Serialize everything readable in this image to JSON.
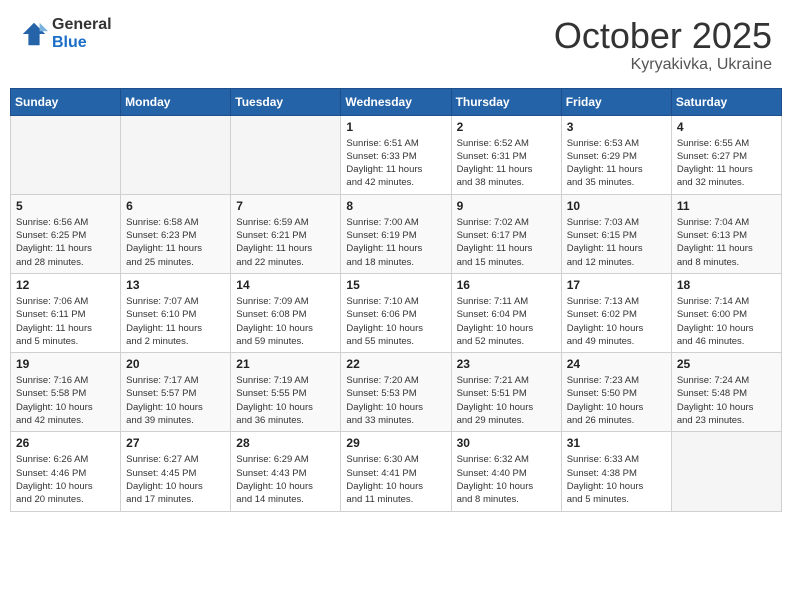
{
  "header": {
    "logo_general": "General",
    "logo_blue": "Blue",
    "month": "October 2025",
    "location": "Kyryakivka, Ukraine"
  },
  "weekdays": [
    "Sunday",
    "Monday",
    "Tuesday",
    "Wednesday",
    "Thursday",
    "Friday",
    "Saturday"
  ],
  "weeks": [
    [
      {
        "day": "",
        "info": ""
      },
      {
        "day": "",
        "info": ""
      },
      {
        "day": "",
        "info": ""
      },
      {
        "day": "1",
        "info": "Sunrise: 6:51 AM\nSunset: 6:33 PM\nDaylight: 11 hours\nand 42 minutes."
      },
      {
        "day": "2",
        "info": "Sunrise: 6:52 AM\nSunset: 6:31 PM\nDaylight: 11 hours\nand 38 minutes."
      },
      {
        "day": "3",
        "info": "Sunrise: 6:53 AM\nSunset: 6:29 PM\nDaylight: 11 hours\nand 35 minutes."
      },
      {
        "day": "4",
        "info": "Sunrise: 6:55 AM\nSunset: 6:27 PM\nDaylight: 11 hours\nand 32 minutes."
      }
    ],
    [
      {
        "day": "5",
        "info": "Sunrise: 6:56 AM\nSunset: 6:25 PM\nDaylight: 11 hours\nand 28 minutes."
      },
      {
        "day": "6",
        "info": "Sunrise: 6:58 AM\nSunset: 6:23 PM\nDaylight: 11 hours\nand 25 minutes."
      },
      {
        "day": "7",
        "info": "Sunrise: 6:59 AM\nSunset: 6:21 PM\nDaylight: 11 hours\nand 22 minutes."
      },
      {
        "day": "8",
        "info": "Sunrise: 7:00 AM\nSunset: 6:19 PM\nDaylight: 11 hours\nand 18 minutes."
      },
      {
        "day": "9",
        "info": "Sunrise: 7:02 AM\nSunset: 6:17 PM\nDaylight: 11 hours\nand 15 minutes."
      },
      {
        "day": "10",
        "info": "Sunrise: 7:03 AM\nSunset: 6:15 PM\nDaylight: 11 hours\nand 12 minutes."
      },
      {
        "day": "11",
        "info": "Sunrise: 7:04 AM\nSunset: 6:13 PM\nDaylight: 11 hours\nand 8 minutes."
      }
    ],
    [
      {
        "day": "12",
        "info": "Sunrise: 7:06 AM\nSunset: 6:11 PM\nDaylight: 11 hours\nand 5 minutes."
      },
      {
        "day": "13",
        "info": "Sunrise: 7:07 AM\nSunset: 6:10 PM\nDaylight: 11 hours\nand 2 minutes."
      },
      {
        "day": "14",
        "info": "Sunrise: 7:09 AM\nSunset: 6:08 PM\nDaylight: 10 hours\nand 59 minutes."
      },
      {
        "day": "15",
        "info": "Sunrise: 7:10 AM\nSunset: 6:06 PM\nDaylight: 10 hours\nand 55 minutes."
      },
      {
        "day": "16",
        "info": "Sunrise: 7:11 AM\nSunset: 6:04 PM\nDaylight: 10 hours\nand 52 minutes."
      },
      {
        "day": "17",
        "info": "Sunrise: 7:13 AM\nSunset: 6:02 PM\nDaylight: 10 hours\nand 49 minutes."
      },
      {
        "day": "18",
        "info": "Sunrise: 7:14 AM\nSunset: 6:00 PM\nDaylight: 10 hours\nand 46 minutes."
      }
    ],
    [
      {
        "day": "19",
        "info": "Sunrise: 7:16 AM\nSunset: 5:58 PM\nDaylight: 10 hours\nand 42 minutes."
      },
      {
        "day": "20",
        "info": "Sunrise: 7:17 AM\nSunset: 5:57 PM\nDaylight: 10 hours\nand 39 minutes."
      },
      {
        "day": "21",
        "info": "Sunrise: 7:19 AM\nSunset: 5:55 PM\nDaylight: 10 hours\nand 36 minutes."
      },
      {
        "day": "22",
        "info": "Sunrise: 7:20 AM\nSunset: 5:53 PM\nDaylight: 10 hours\nand 33 minutes."
      },
      {
        "day": "23",
        "info": "Sunrise: 7:21 AM\nSunset: 5:51 PM\nDaylight: 10 hours\nand 29 minutes."
      },
      {
        "day": "24",
        "info": "Sunrise: 7:23 AM\nSunset: 5:50 PM\nDaylight: 10 hours\nand 26 minutes."
      },
      {
        "day": "25",
        "info": "Sunrise: 7:24 AM\nSunset: 5:48 PM\nDaylight: 10 hours\nand 23 minutes."
      }
    ],
    [
      {
        "day": "26",
        "info": "Sunrise: 6:26 AM\nSunset: 4:46 PM\nDaylight: 10 hours\nand 20 minutes."
      },
      {
        "day": "27",
        "info": "Sunrise: 6:27 AM\nSunset: 4:45 PM\nDaylight: 10 hours\nand 17 minutes."
      },
      {
        "day": "28",
        "info": "Sunrise: 6:29 AM\nSunset: 4:43 PM\nDaylight: 10 hours\nand 14 minutes."
      },
      {
        "day": "29",
        "info": "Sunrise: 6:30 AM\nSunset: 4:41 PM\nDaylight: 10 hours\nand 11 minutes."
      },
      {
        "day": "30",
        "info": "Sunrise: 6:32 AM\nSunset: 4:40 PM\nDaylight: 10 hours\nand 8 minutes."
      },
      {
        "day": "31",
        "info": "Sunrise: 6:33 AM\nSunset: 4:38 PM\nDaylight: 10 hours\nand 5 minutes."
      },
      {
        "day": "",
        "info": ""
      }
    ]
  ]
}
